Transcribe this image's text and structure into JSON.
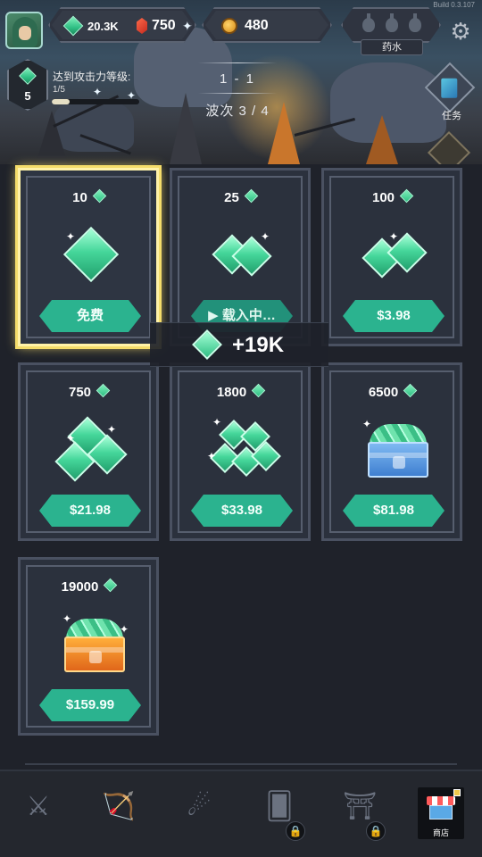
{
  "build": "Build 0.3.107",
  "header": {
    "gems": "20.3K",
    "rubies": "750",
    "coins": "480",
    "potion_label": "药水"
  },
  "attack": {
    "level": "5",
    "title": "达到攻击力等级:",
    "progress_text": "1/5",
    "progress": 0.2
  },
  "stage": {
    "label": "1 - 1",
    "wave": "波次 3 / 4"
  },
  "tasks": {
    "label": "任务"
  },
  "shop": {
    "items": [
      {
        "amount": "10",
        "price": "免费"
      },
      {
        "amount": "25",
        "price": "▶ 载入中…"
      },
      {
        "amount": "100",
        "price": "$3.98"
      },
      {
        "amount": "750",
        "price": "$21.98"
      },
      {
        "amount": "1800",
        "price": "$33.98"
      },
      {
        "amount": "6500",
        "price": "$81.98"
      },
      {
        "amount": "19000",
        "price": "$159.99"
      }
    ]
  },
  "reward_toast": "+19K",
  "nav": {
    "shop_label": "商店"
  },
  "colors": {
    "accent_green": "#2bb38f",
    "highlight_gold": "#f4dc6a"
  }
}
